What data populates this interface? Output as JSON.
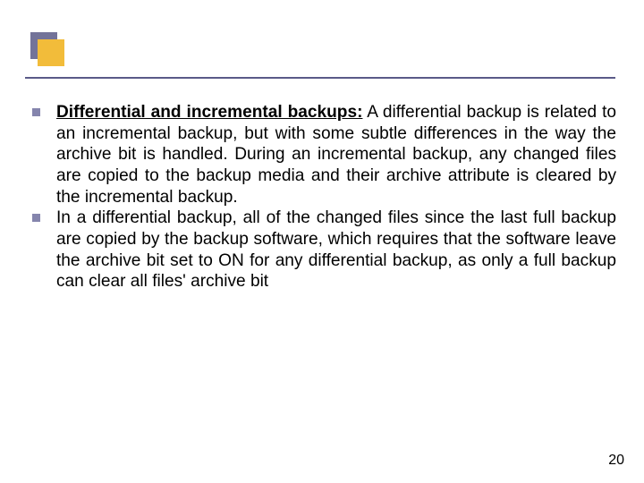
{
  "logo": {
    "name": "slide-logo"
  },
  "bullets": [
    {
      "heading": "Differential and incremental backups:",
      "body": " A differential backup is related to an incremental backup, but with some subtle differences in the way the archive bit is handled. During an incremental backup, any changed files are copied to the backup media and their archive attribute is cleared by the incremental backup."
    },
    {
      "heading": "",
      "body": " In a differential backup, all of the changed files since the last full backup are copied by the backup software, which requires that the software leave the archive bit set to ON for any differential backup, as only a full backup can clear all files' archive bit"
    }
  ],
  "page_number": "20"
}
